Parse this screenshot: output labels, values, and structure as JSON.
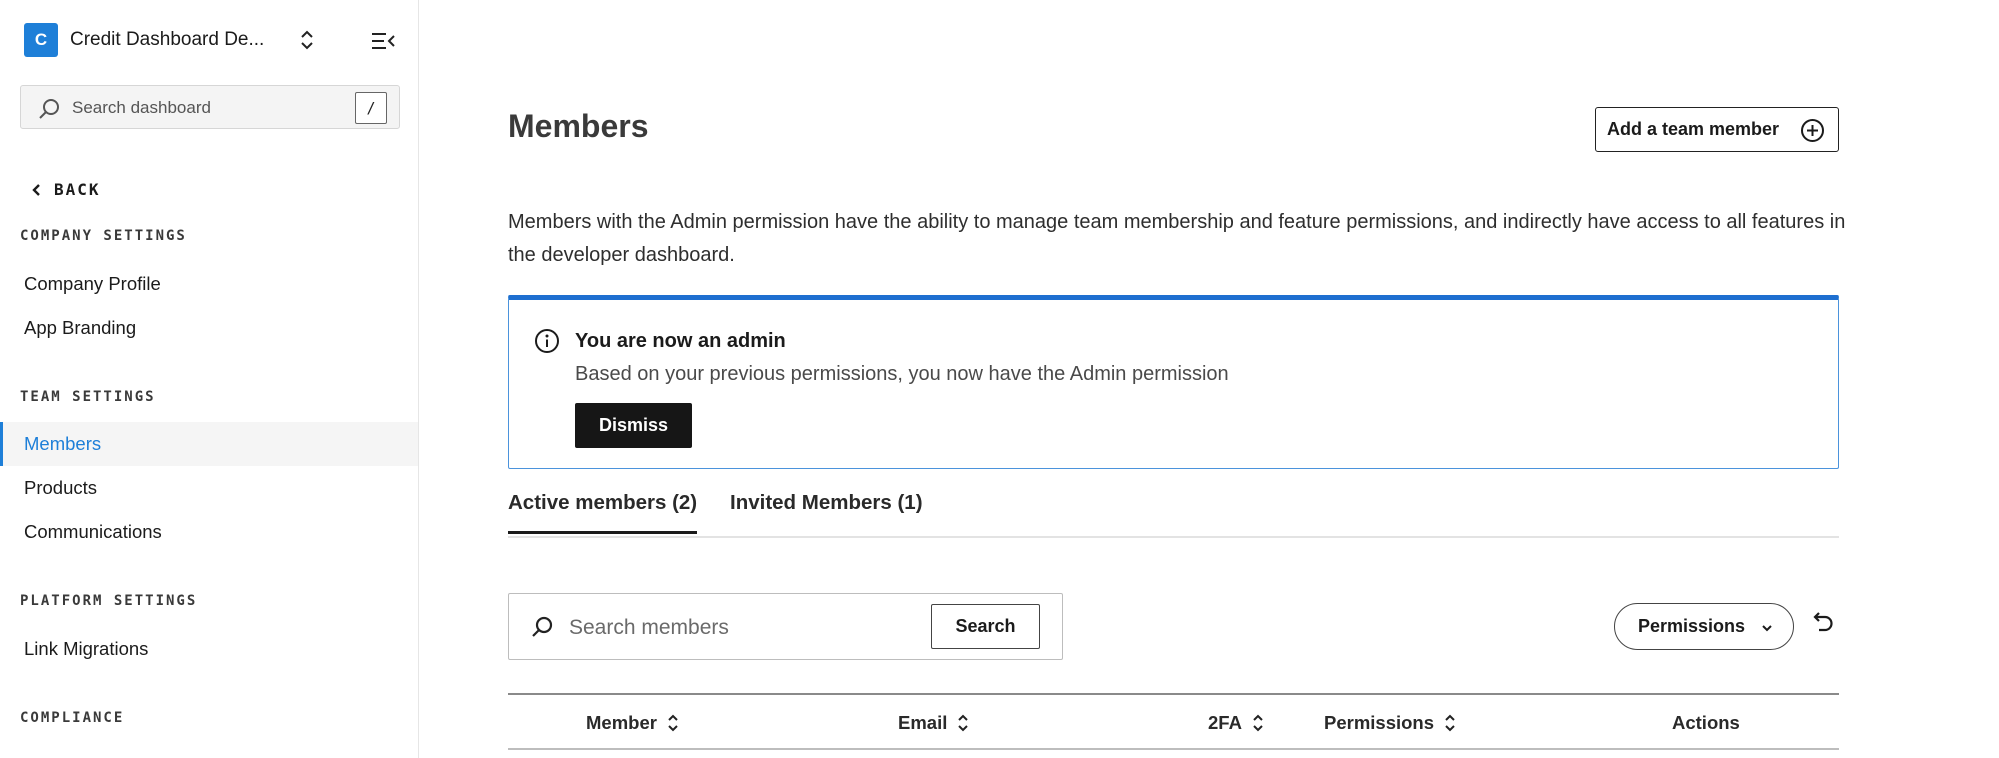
{
  "sidebar": {
    "workspace": {
      "initial": "C",
      "name": "Credit Dashboard De..."
    },
    "search": {
      "placeholder": "Search dashboard",
      "shortcut": "/"
    },
    "back_label": "BACK",
    "sections": [
      {
        "title": "COMPANY SETTINGS",
        "items": [
          {
            "label": "Company Profile"
          },
          {
            "label": "App Branding"
          }
        ]
      },
      {
        "title": "TEAM SETTINGS",
        "items": [
          {
            "label": "Members",
            "active": true
          },
          {
            "label": "Products"
          },
          {
            "label": "Communications"
          }
        ]
      },
      {
        "title": "PLATFORM SETTINGS",
        "items": [
          {
            "label": "Link Migrations"
          }
        ]
      },
      {
        "title": "COMPLIANCE",
        "items": []
      }
    ]
  },
  "main": {
    "title": "Members",
    "add_button_label": "Add a team member",
    "intro_text": "Members with the Admin permission have the ability to manage team membership and feature permissions, and indirectly have access to all features in the developer dashboard.",
    "alert": {
      "title": "You are now an admin",
      "body": "Based on your previous permissions, you now have the Admin permission",
      "dismiss_label": "Dismiss"
    },
    "tabs": [
      {
        "label": "Active members (2)",
        "active": true
      },
      {
        "label": "Invited Members (1)",
        "active": false
      }
    ],
    "member_search": {
      "placeholder": "Search members",
      "button_label": "Search"
    },
    "permissions_filter_label": "Permissions",
    "table": {
      "columns": [
        {
          "label": "Member",
          "sortable": true
        },
        {
          "label": "Email",
          "sortable": true
        },
        {
          "label": "2FA",
          "sortable": true
        },
        {
          "label": "Permissions",
          "sortable": true
        },
        {
          "label": "Actions",
          "sortable": false
        }
      ]
    }
  },
  "colors": {
    "accent": "#1e7fd8",
    "alert_border": "#1e6fd0",
    "dark_button": "#161616"
  },
  "icons": [
    "chevron-up-down-icon",
    "sidebar-collapse-icon",
    "search-icon",
    "chevron-left-icon",
    "plus-circle-icon",
    "info-icon",
    "chevron-down-icon",
    "undo-icon",
    "sort-icon"
  ]
}
